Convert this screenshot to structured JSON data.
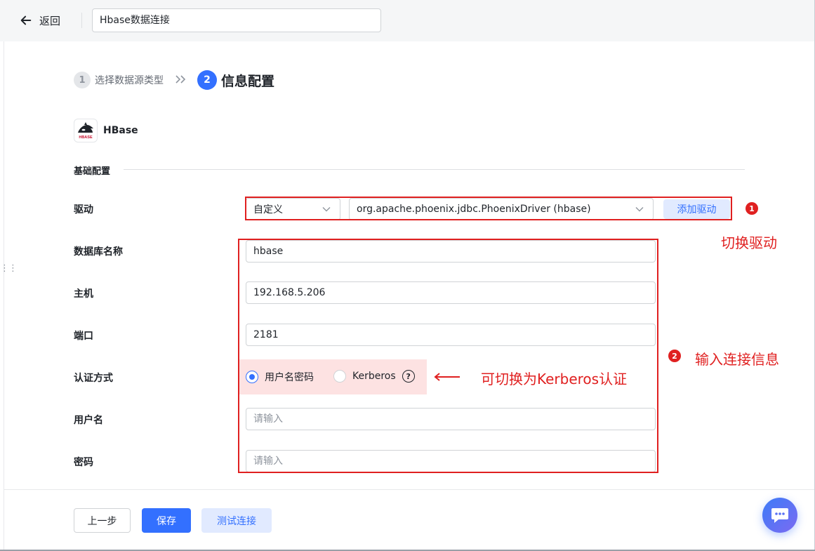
{
  "topbar": {
    "back_label": "返回",
    "title_value": "Hbase数据连接"
  },
  "steps": {
    "step1_num": "1",
    "step1_label": "选择数据源类型",
    "separator": "»",
    "step2_num": "2",
    "step2_label": "信息配置"
  },
  "datasource": {
    "logo_text": "HBASE",
    "name": "HBase"
  },
  "section": {
    "title": "基础配置"
  },
  "form": {
    "driver_label": "驱动",
    "driver_type": "自定义",
    "driver_class": "org.apache.phoenix.jdbc.PhoenixDriver (hbase)",
    "add_driver": "添加驱动",
    "db_name_label": "数据库名称",
    "db_name_value": "hbase",
    "host_label": "主机",
    "host_value": "192.168.5.206",
    "port_label": "端口",
    "port_value": "2181",
    "auth_label": "认证方式",
    "auth_options": [
      "用户名密码",
      "Kerberos"
    ],
    "auth_help": "?",
    "username_label": "用户名",
    "username_placeholder": "请输入",
    "password_label": "密码",
    "password_placeholder": "请输入"
  },
  "annotations": {
    "badge1": "1",
    "switch_driver": "切换驱动",
    "badge2": "2",
    "input_info": "输入连接信息",
    "switch_kerberos": "可切换为Kerberos认证"
  },
  "footer": {
    "prev": "上一步",
    "save": "保存",
    "test": "测试连接"
  },
  "colors": {
    "accent": "#3370ff",
    "annotation_red": "#e02020",
    "highlight_pink": "#fde2e2"
  }
}
